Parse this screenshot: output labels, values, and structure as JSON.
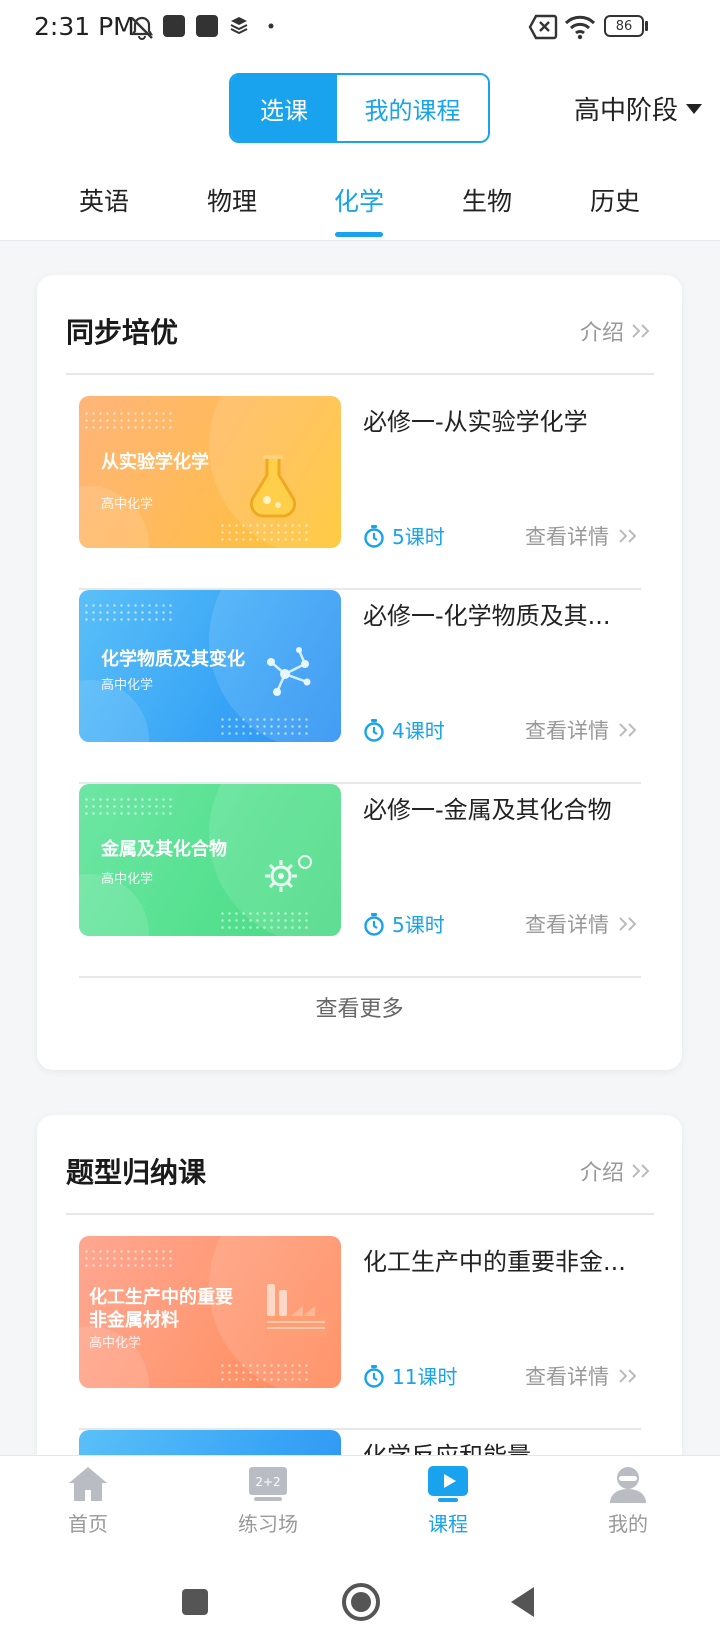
{
  "status_bar": {
    "time": "2:31 PM",
    "battery": "86",
    "icons": [
      "muted-bell-icon",
      "app-square-icon",
      "app-square-icon",
      "layers-icon",
      "dot-icon",
      "sim-x-icon",
      "wifi-icon",
      "battery-icon"
    ]
  },
  "header": {
    "segment": {
      "select_course": "选课",
      "my_courses": "我的课程"
    },
    "stage": "高中阶段",
    "subjects": [
      "英语",
      "物理",
      "化学",
      "生物",
      "历史"
    ],
    "active_subject": "化学"
  },
  "sections": [
    {
      "title": "同步培优",
      "intro": "介绍",
      "courses": [
        {
          "thumb_title": "从实验学化学",
          "thumb_sub": "高中化学",
          "name": "必修一-从实验学化学",
          "hours": "5课时",
          "detail": "查看详情",
          "theme": "orange",
          "thumb_icon": "flask-icon"
        },
        {
          "thumb_title": "化学物质及其变化",
          "thumb_sub": "高中化学",
          "name": "必修一-化学物质及其...",
          "hours": "4课时",
          "detail": "查看详情",
          "theme": "blue",
          "thumb_icon": "molecule-icon"
        },
        {
          "thumb_title": "金属及其化合物",
          "thumb_sub": "高中化学",
          "name": "必修一-金属及其化合物",
          "hours": "5课时",
          "detail": "查看详情",
          "theme": "green",
          "thumb_icon": "gear-icon"
        }
      ],
      "see_more": "查看更多"
    },
    {
      "title": "题型归纳课",
      "intro": "介绍",
      "courses": [
        {
          "thumb_title_line1": "化工生产中的重要",
          "thumb_title_line2": "非金属材料",
          "thumb_sub": "高中化学",
          "name": "化工生产中的重要非金...",
          "hours": "11课时",
          "detail": "查看详情",
          "theme": "coral",
          "thumb_icon": "factory-icon"
        },
        {
          "name": "化学反应和能量",
          "theme": "blue"
        }
      ]
    }
  ],
  "bottom_nav": [
    {
      "label": "首页",
      "icon": "home-icon"
    },
    {
      "label": "练习场",
      "icon": "practice-board-icon"
    },
    {
      "label": "课程",
      "icon": "course-play-icon",
      "active": true
    },
    {
      "label": "我的",
      "icon": "profile-icon"
    }
  ],
  "colors": {
    "accent": "#19a3ee",
    "orange": "#ffb84a",
    "blue": "#2f9df3",
    "green": "#52e08a",
    "coral": "#ff8a63"
  }
}
